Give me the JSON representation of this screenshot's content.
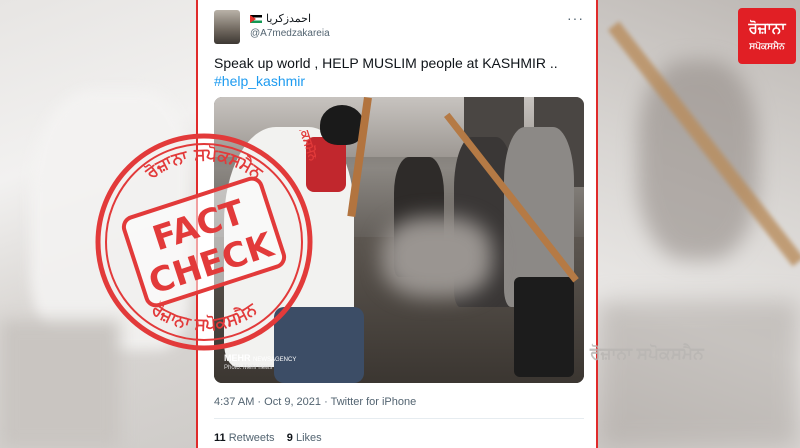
{
  "tweet": {
    "display_name": "احمدزكريا",
    "handle": "@A7medzakareia",
    "more": "···",
    "text": "Speak up world , HELP MUSLIM people at KASHMIR ..",
    "hashtag": "#help_kashmir",
    "time": "4:37 AM",
    "date": "Oct 9, 2021",
    "source": "Twitter for iPhone",
    "retweets_count": "11",
    "retweets_label": "Retweets",
    "likes_count": "9",
    "likes_label": "Likes"
  },
  "media": {
    "agency_main": "MEHR",
    "agency_sub": "NEWSAGENCY",
    "credit": "Photo: Mehr news"
  },
  "logo": {
    "line1": "ਰੋਜ਼ਾਨਾ",
    "line2": "ਸਪੋਕਸਮੈਨ"
  },
  "stamp": {
    "top_text": "ਰੋਜ਼ਾਨਾ ਸਪੋਕਸਮੈਨ",
    "bottom_text": "ਰੋਜ਼ਾਨਾ ਸਪੋਕਸਮੈਨ",
    "main_line1": "FACT",
    "main_line2": "CHECK",
    "side_text": "ਰੋਜ਼ਾਨਾ ਸਪੋਕਸਮੈਨ"
  },
  "watermark_right": "ਰੋਜ਼ਾਨਾ ਸਪੋਕਸਮੈਨ",
  "colors": {
    "brand_red": "#e11f25",
    "stamp_red": "#e23a3a",
    "link_blue": "#1d9bf0"
  }
}
